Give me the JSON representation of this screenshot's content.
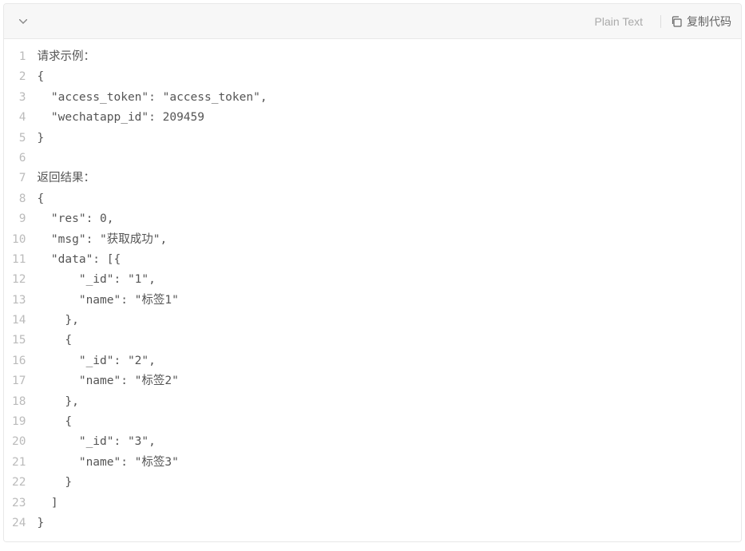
{
  "header": {
    "language": "Plain Text",
    "copyLabel": "复制代码"
  },
  "code": {
    "lines": [
      "请求示例：",
      "{",
      "  \"access_token\": \"access_token\",",
      "  \"wechatapp_id\": 209459",
      "}",
      "",
      "返回结果：",
      "{",
      "  \"res\": 0,",
      "  \"msg\": \"获取成功\",",
      "  \"data\": [{",
      "      \"_id\": \"1\",",
      "      \"name\": \"标签1\"",
      "    },",
      "    {",
      "      \"_id\": \"2\",",
      "      \"name\": \"标签2\"",
      "    },",
      "    {",
      "      \"_id\": \"3\",",
      "      \"name\": \"标签3\"",
      "    }",
      "  ]",
      "}"
    ]
  }
}
